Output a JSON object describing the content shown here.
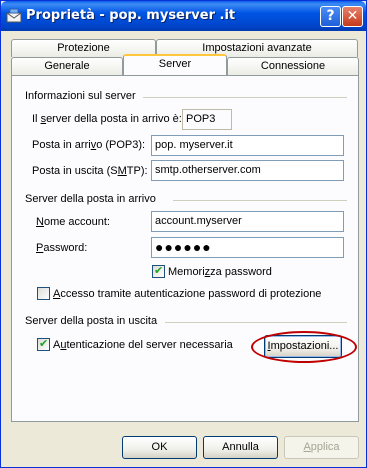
{
  "window": {
    "title": "Proprietà - pop. myserver .it"
  },
  "title_buttons": {
    "help": "?",
    "close": "✕"
  },
  "tabs": {
    "row1": [
      "Protezione",
      "Impostazioni avanzate"
    ],
    "row2": [
      "Generale",
      "Server",
      "Connessione"
    ],
    "active": "Server"
  },
  "server_info": {
    "title": "Informazioni sul server",
    "incoming_type_label_pre": "Il ",
    "incoming_type_label_u": "s",
    "incoming_type_label_post": "erver della posta in arrivo è:",
    "incoming_type_value": "POP3",
    "incoming_label_pre": "Posta in arri",
    "incoming_label_u": "v",
    "incoming_label_post": "o (POP3):",
    "incoming_value": "pop. myserver.it",
    "outgoing_label_pre": "Posta in uscita (S",
    "outgoing_label_u": "M",
    "outgoing_label_post": "TP):",
    "outgoing_value": "smtp.otherserver.com"
  },
  "incoming_server": {
    "title": "Server della posta in arrivo",
    "account_label_u": "N",
    "account_label_post": "ome account:",
    "account_value": "account.myserver",
    "password_label_u": "P",
    "password_label_post": "assword:",
    "password_value": "●●●●●●",
    "remember_label_pre": "Memori",
    "remember_label_u": "z",
    "remember_label_post": "za password",
    "remember_checked": true,
    "spa_label_pre": "",
    "spa_label_u": "A",
    "spa_label_post": "ccesso tramite autenticazione password di protezione",
    "spa_checked": false
  },
  "outgoing_server": {
    "title": "Server della posta in uscita",
    "auth_label_pre": "A",
    "auth_label_u": "u",
    "auth_label_post": "tenticazione del server necessaria",
    "auth_checked": true,
    "settings_button_pre": "",
    "settings_button_u": "I",
    "settings_button_post": "mpostazioni..."
  },
  "footer": {
    "ok": "OK",
    "cancel": "Annulla",
    "apply_u": "A",
    "apply_post": "pplica"
  },
  "colors": {
    "titlebar": "#0055e5",
    "annotation_ellipse": "#c00000",
    "checkmark": "#21a121",
    "active_tab_highlight": "#ffc83c"
  }
}
